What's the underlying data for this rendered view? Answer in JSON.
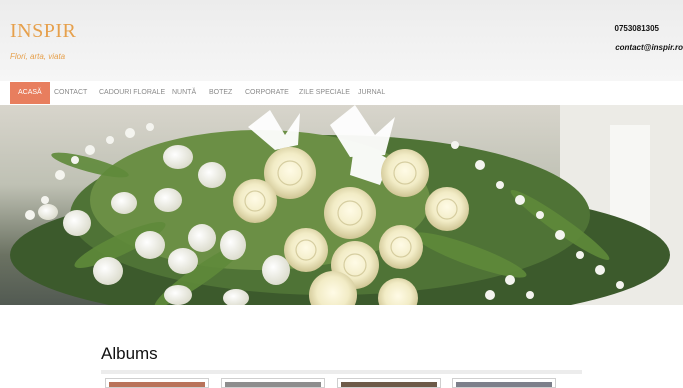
{
  "header": {
    "logo": "INSPIR",
    "tagline": "Flori, arta, viata",
    "phone": "0753081305",
    "email": "contact@inspir.ro"
  },
  "nav": {
    "items": [
      {
        "label": "ACASĂ",
        "active": true
      },
      {
        "label": "CONTACT",
        "active": false
      },
      {
        "label": "CADOURI FLORALE",
        "active": false
      },
      {
        "label": "NUNTĂ",
        "active": false
      },
      {
        "label": "BOTEZ",
        "active": false
      },
      {
        "label": "CORPORATE",
        "active": false
      },
      {
        "label": "ZILE SPECIALE",
        "active": false
      },
      {
        "label": "JURNAL",
        "active": false
      }
    ]
  },
  "hero": {
    "image": "white-roses-lilies-arrangement"
  },
  "albums": {
    "title": "Albums",
    "thumbnails": [
      {
        "color": "#b9735a"
      },
      {
        "color": "#8d8d8d"
      },
      {
        "color": "#6d5a48"
      },
      {
        "color": "#7c7f8a"
      }
    ]
  }
}
